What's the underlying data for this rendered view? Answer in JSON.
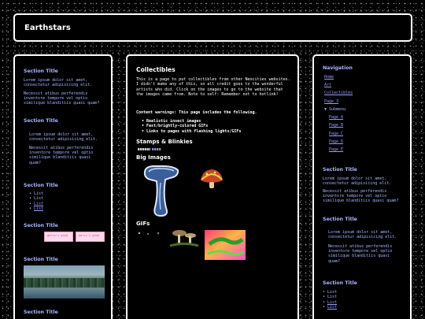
{
  "site": {
    "title": "Earthstars"
  },
  "left": {
    "sections": [
      {
        "title": "Section Title",
        "p1": "Lorem ipsum dolor sit amet, consectetur adipisicing elit.",
        "p2": "Necessit atibus perferendis inventore tempore vel optio similique blanditiis quasi quam?"
      },
      {
        "title": "Section Title",
        "p1": "Lorem ipsum dolor sit amet, consectetur adipisicing elit.",
        "p2": "Necessit atibus perferendis inventore tempore vel optio similique blanditiis quasi quam?"
      },
      {
        "title": "Section Title",
        "items": [
          "List",
          "List",
          "List",
          "List"
        ]
      },
      {
        "title": "Section Title",
        "badge": "garry's good"
      },
      {
        "title": "Section Title"
      },
      {
        "title": "Section Title"
      }
    ]
  },
  "main": {
    "title": "Collectibles",
    "intro": "This is a page to put collectibles from other Neocities websites. I didn't make any of this, so all credit goes to the wonderful artists who did. Click on the images to go to the website that the images came from. Note to self: Remember not to hotlink!",
    "warning_intro": "Content warnings: This page includes the following.",
    "warnings": [
      "Realistic insect images",
      "Fast/brightly-colored GIFs",
      "Links to pages with flashing lights/GIFs"
    ],
    "stamps_title": "Stamps & Blinkies",
    "big_images_title": "Big Images",
    "gifs_title": "GIFs"
  },
  "right": {
    "nav_title": "Navigation",
    "nav": {
      "home": "Home",
      "art": "Art",
      "collectibles": "Collectibles",
      "page3": "Page 3",
      "submenu": "▼ Submenu",
      "pageA": "Page A",
      "pageB": "Page B",
      "pageC": "Page C",
      "pageD": "Page D",
      "pageE": "Page E"
    },
    "sections": [
      {
        "title": "Section Title",
        "p1": "Lorem ipsum dolor sit amet, consectetur adipisicing elit.",
        "p2": "Necessit atibus perferendis inventore tempore vel optio similique blanditiis quasi quam?"
      },
      {
        "title": "Section Title",
        "p1": "Lorem ipsum dolor sit amet, consectetur adipisicing elit.",
        "p2": "Necessit atibus perferendis inventore tempore vel optio similique blanditiis quasi quam?"
      },
      {
        "title": "Section Title",
        "items": [
          "List",
          "List",
          "List",
          "List"
        ]
      }
    ]
  },
  "colors": {
    "background": "#000000",
    "border": "#ffffff",
    "accent_text": "#a9b6ff",
    "link": "#9a9cff"
  }
}
